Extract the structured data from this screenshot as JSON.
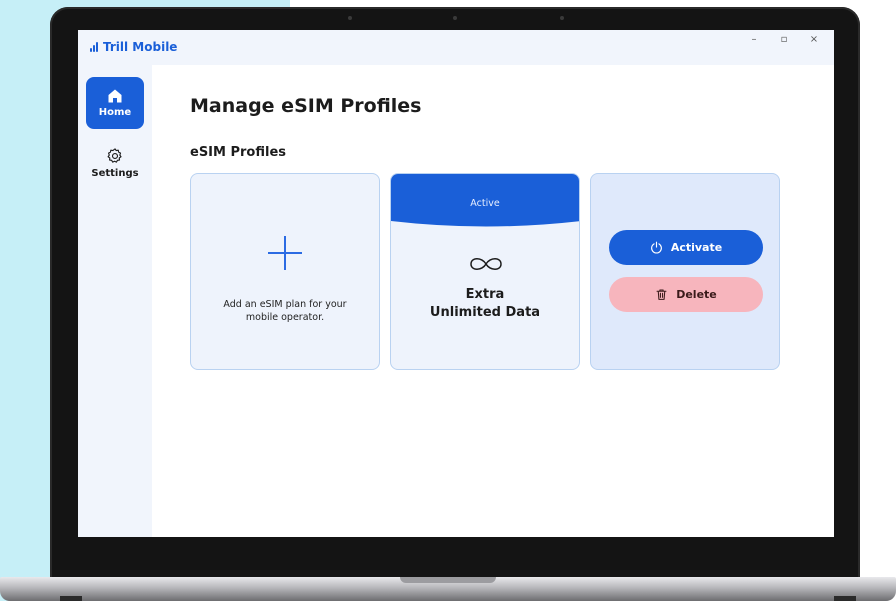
{
  "app": {
    "name": "Trill Mobile",
    "window_controls": [
      "–",
      "▫",
      "×"
    ]
  },
  "sidebar": {
    "items": [
      {
        "label": "Home",
        "icon": "home-icon",
        "active": true
      },
      {
        "label": "Settings",
        "icon": "gear-icon",
        "active": false
      }
    ]
  },
  "main": {
    "page_title": "Manage eSIM Profiles",
    "section_title": "eSIM Profiles",
    "add_card": {
      "icon": "plus-icon",
      "text": "Add an eSIM plan for your mobile operator."
    },
    "plan_card": {
      "status": "Active",
      "icon": "infinity-icon",
      "name_line1": "Extra",
      "name_line2": "Unlimited Data"
    },
    "actions": {
      "activate_label": "Activate",
      "delete_label": "Delete"
    }
  },
  "colors": {
    "accent": "#1a5fd8",
    "card_bg": "#eef3fc",
    "card_border": "#b9d2f1",
    "delete_bg": "#f7b5bd",
    "sidebar_bg": "#f1f5fc"
  }
}
